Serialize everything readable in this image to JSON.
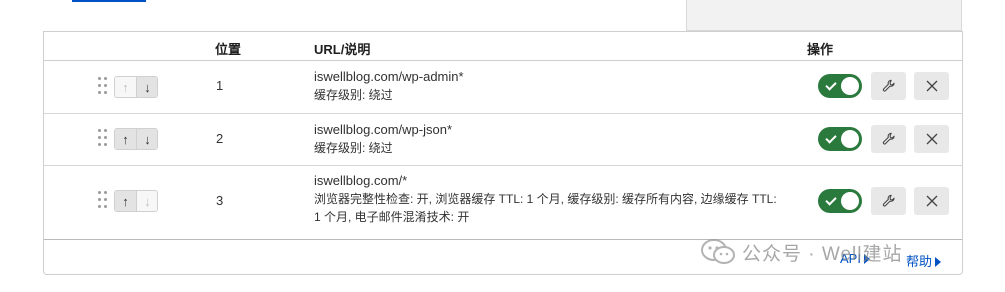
{
  "table": {
    "headers": {
      "position": "位置",
      "url": "URL/说明",
      "actions": "操作"
    },
    "rows": [
      {
        "position": "1",
        "url": "iswellblog.com/wp-admin*",
        "desc": "缓存级别: 绕过",
        "enabled": true,
        "up_disabled": true,
        "down_disabled": false
      },
      {
        "position": "2",
        "url": "iswellblog.com/wp-json*",
        "desc": "缓存级别: 绕过",
        "enabled": true,
        "up_disabled": false,
        "down_disabled": false
      },
      {
        "position": "3",
        "url": "iswellblog.com/*",
        "desc": "浏览器完整性检查: 开, 浏览器缓存 TTL: 1 个月, 缓存级别: 缓存所有内容, 边缘缓存 TTL: 1 个月, 电子邮件混淆技术: 开",
        "enabled": true,
        "up_disabled": false,
        "down_disabled": true
      }
    ]
  },
  "footer": {
    "api_label": "API",
    "help_label": "帮助"
  },
  "watermark": {
    "text": "公众号 · Well建站"
  },
  "colors": {
    "toggle_on": "#2b7a3d",
    "link": "#0051c3",
    "border": "#cfcfcf"
  },
  "icons": {
    "drag": "drag-handle-icon",
    "up": "arrow-up-icon",
    "down": "arrow-down-icon",
    "edit": "wrench-icon",
    "delete": "close-icon"
  }
}
